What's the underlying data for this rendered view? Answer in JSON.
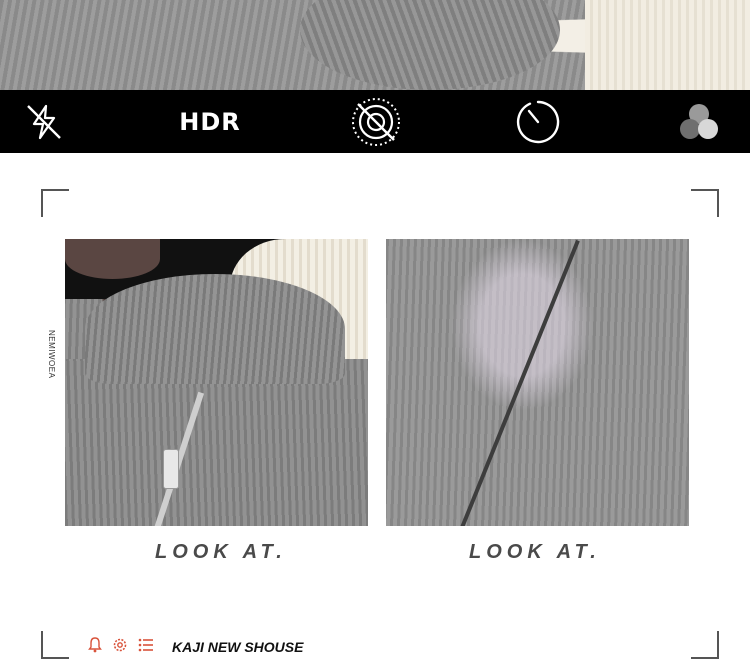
{
  "camera_bar": {
    "hdr_label": "HDR",
    "icons": [
      "flash-off-icon",
      "live-photo-off-icon",
      "timer-icon",
      "filters-icon"
    ]
  },
  "captions": {
    "left": "LOOK AT.",
    "right": "LOOK AT."
  },
  "side_text": "NEMIWOEA",
  "footer": {
    "brand": "KAJI NEW SHOUSE",
    "icons": [
      "bell-icon",
      "gear-icon",
      "list-icon"
    ],
    "icon_color": "#d9533b"
  }
}
